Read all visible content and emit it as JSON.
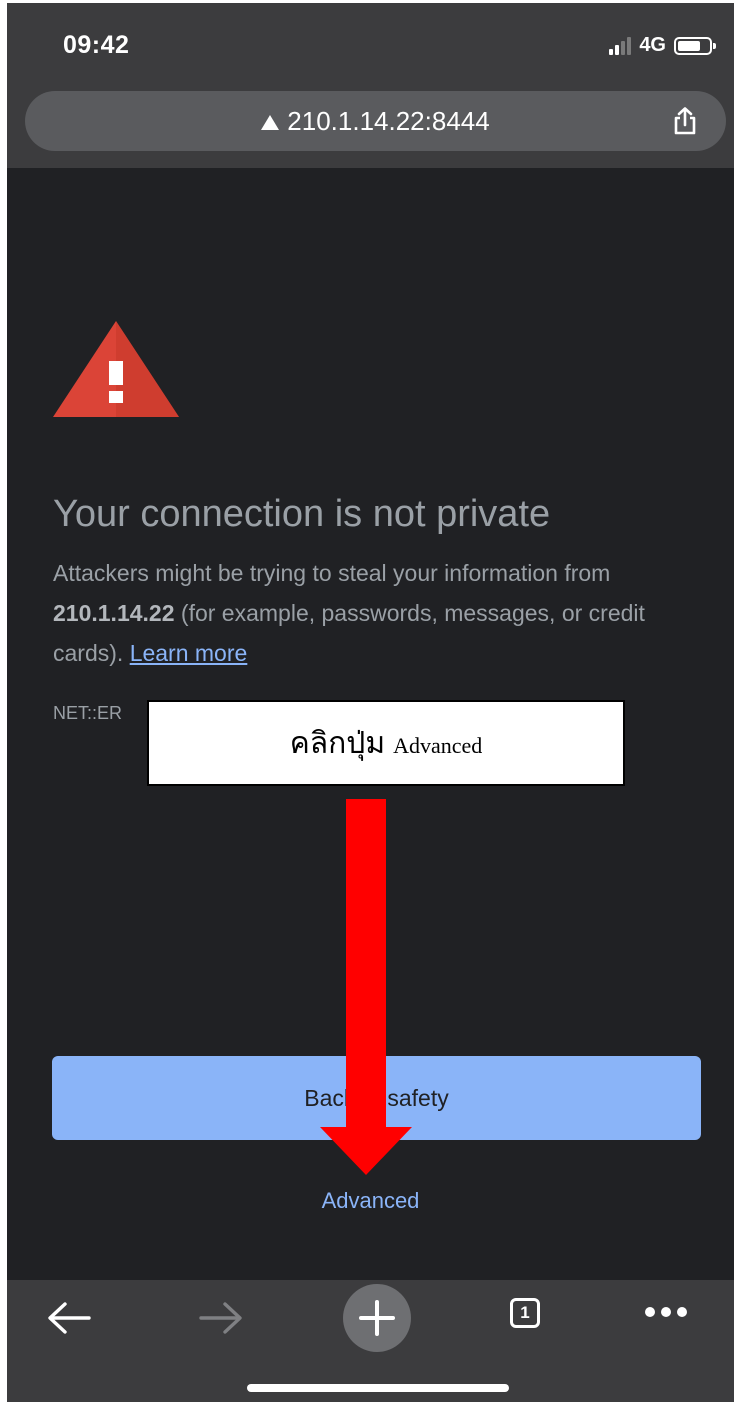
{
  "status_bar": {
    "time": "09:42",
    "network": "4G"
  },
  "address_bar": {
    "url": "210.1.14.22:8444"
  },
  "interstitial": {
    "heading": "Your connection is not private",
    "description_prefix": "Attackers might be trying to steal your information from ",
    "host": "210.1.14.22",
    "description_suffix": " (for example, passwords, messages, or credit cards). ",
    "learn_more": "Learn more",
    "error_code_visible": "NET::ER",
    "primary_button": "Back to safety",
    "advanced_link": "Advanced"
  },
  "annotation": {
    "thai_text": "คลิกปุ่ม",
    "english_text": "Advanced",
    "arrow_color": "#ff0000"
  },
  "toolbar": {
    "tab_count": "1"
  },
  "colors": {
    "page_bg": "#202124",
    "chrome_bg": "#3c3c3e",
    "accent_blue": "#8ab4f8",
    "warning_red": "#db4437"
  }
}
